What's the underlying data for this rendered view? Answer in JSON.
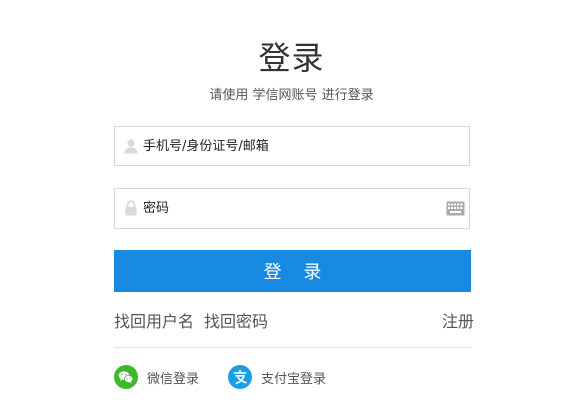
{
  "header": {
    "title": "登录",
    "subtitle": "请使用 学信网账号 进行登录"
  },
  "form": {
    "username_placeholder": "手机号/身份证号/邮箱",
    "password_placeholder": "密码",
    "submit_label": "登 录"
  },
  "links": {
    "find_username": "找回用户名",
    "find_password": "找回密码",
    "register": "注册"
  },
  "social": {
    "wechat_label": "微信登录",
    "alipay_label": "支付宝登录"
  },
  "icons": {
    "username": "user-icon",
    "password": "lock-icon",
    "keyboard": "keyboard-icon",
    "wechat": "wechat-icon",
    "alipay": "alipay-icon"
  },
  "colors": {
    "primary": "#1789e0",
    "wechat": "#3fb82f",
    "alipay": "#1a9ee8"
  }
}
